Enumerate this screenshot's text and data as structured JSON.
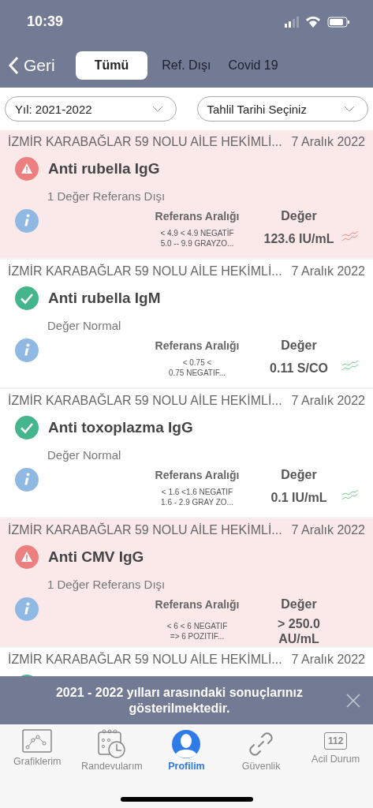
{
  "status_bar": {
    "time": "10:39"
  },
  "nav": {
    "back": "Geri",
    "tabs": [
      {
        "label": "Tümü",
        "selected": true
      },
      {
        "label": "Ref. Dışı",
        "selected": false
      },
      {
        "label": "Covid 19",
        "selected": false
      }
    ]
  },
  "filters": [
    {
      "value": "Yıl: 2021-2022"
    },
    {
      "value": "Tahlil Tarihi Seçiniz"
    }
  ],
  "results": [
    {
      "source": "İZMİR KARABAĞLAR 59 NOLU AİLE HEKİMLİ...",
      "date": "7 Aralık 2022",
      "out_of_range": true,
      "title": "Anti rubella IgG",
      "subtitle": "1 Değer Referans Dışı",
      "range_label": "Referans Aralığı",
      "value_label": "Değer",
      "range": [
        "< 4.9 < 4.9 NEGATİF",
        "5.0 -- 9.9 GRAYZO..."
      ],
      "value": [
        "123.6 IU/mL"
      ]
    },
    {
      "source": "İZMİR KARABAĞLAR 59 NOLU AİLE HEKİMLİ...",
      "date": "7 Aralık 2022",
      "out_of_range": false,
      "title": "Anti rubella IgM",
      "subtitle": "Değer Normal",
      "range_label": "Referans Aralığı",
      "value_label": "Değer",
      "range": [
        "< 0.75 <",
        "0.75 NEGATIF..."
      ],
      "value": [
        "0.11 S/CO"
      ]
    },
    {
      "source": "İZMİR KARABAĞLAR 59 NOLU AİLE HEKİMLİ...",
      "date": "7 Aralık 2022",
      "out_of_range": false,
      "title": "Anti toxoplazma IgG",
      "subtitle": "Değer Normal",
      "range_label": "Referans Aralığı",
      "value_label": "Değer",
      "range": [
        "< 1.6 <1.6 NEGATIF",
        "1.6 - 2.9 GRAY ZO..."
      ],
      "value": [
        "0.1 IU/mL"
      ]
    },
    {
      "source": "İZMİR KARABAĞLAR 59 NOLU AİLE HEKİMLİ...",
      "date": "7 Aralık 2022",
      "out_of_range": true,
      "title": "Anti CMV IgG",
      "subtitle": "1 Değer Referans Dışı",
      "range_label": "Referans Aralığı",
      "value_label": "Değer",
      "range": [
        "< 6 < 6 NEGATIF",
        "=> 6 POZITIF..."
      ],
      "value": [
        "> 250.0",
        "AU/mL"
      ]
    },
    {
      "source": "İZMİR KARABAĞLAR 59 NOLU AİLE HEKİMLİ...",
      "date": "7 Aralık 2022",
      "out_of_range": false
    }
  ],
  "toast": {
    "message": "2021 - 2022 yılları arasındaki sonuçlarınız gösterilmektedir."
  },
  "tab_bar": [
    {
      "kind": "chart",
      "label": "Grafiklerim",
      "selected": false
    },
    {
      "kind": "calendar",
      "label": "Randevularım",
      "selected": false
    },
    {
      "kind": "profile",
      "label": "Profilim",
      "selected": true
    },
    {
      "kind": "link",
      "label": "Güvenlik",
      "selected": false
    },
    {
      "kind": "emergency",
      "label": "Acil Durum",
      "badge": "112",
      "selected": false
    }
  ]
}
